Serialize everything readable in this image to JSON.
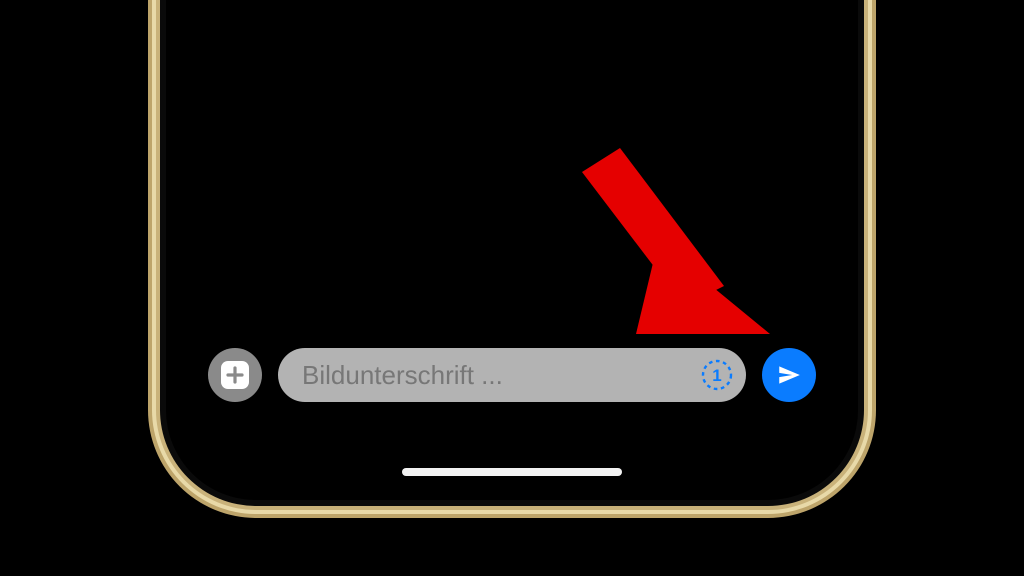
{
  "composer": {
    "caption_placeholder": "Bildunterschrift ...",
    "caption_value": "",
    "view_once_digit": "1"
  },
  "colors": {
    "send_accent": "#0a7cff",
    "view_once_accent": "#0a7cff",
    "arrow_color": "#e50000"
  },
  "icons": {
    "add": "plus-icon",
    "view_once": "view-once-icon",
    "send": "send-icon",
    "annotation": "red-arrow-annotation"
  }
}
